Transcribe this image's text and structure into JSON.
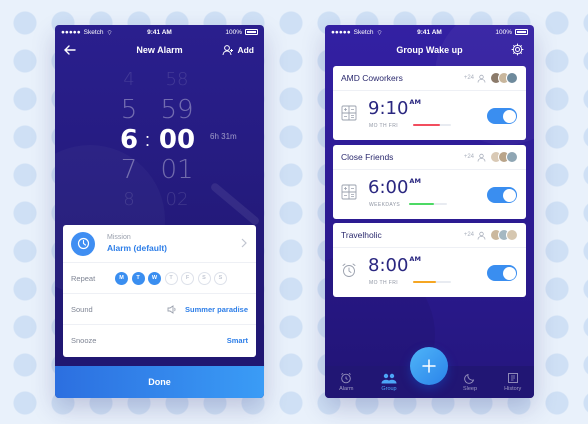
{
  "colors": {
    "accent": "#3a8ef0",
    "phone_bg": "#2a1f8e",
    "red_bar": "#f24d5e",
    "green_bar": "#4cd964",
    "orange_bar": "#f5a623"
  },
  "left_screen": {
    "status": {
      "carrier": "Sketch",
      "time": "9:41 AM",
      "battery": "100%"
    },
    "nav": {
      "title": "New Alarm",
      "back_icon": "arrow-left-icon",
      "add_label": "Add",
      "add_icon": "add-person-icon"
    },
    "picker": {
      "hours": [
        "4",
        "5",
        "6",
        "7",
        "8"
      ],
      "minutes": [
        "58",
        "59",
        "00",
        "01",
        "02"
      ],
      "selected_hour": "6",
      "selected_minute": "00",
      "remaining": "6h 31m"
    },
    "mission": {
      "label": "Mission",
      "value": "Alarm (default)",
      "icon": "clock-icon"
    },
    "repeat": {
      "label": "Repeat",
      "days": [
        {
          "d": "M",
          "on": true
        },
        {
          "d": "T",
          "on": true
        },
        {
          "d": "W",
          "on": true
        },
        {
          "d": "T",
          "on": false
        },
        {
          "d": "F",
          "on": false
        },
        {
          "d": "S",
          "on": false
        },
        {
          "d": "S",
          "on": false
        }
      ]
    },
    "sound": {
      "label": "Sound",
      "value": "Summer paradise",
      "icon": "speaker-icon"
    },
    "snooze": {
      "label": "Snooze",
      "value": "Smart"
    },
    "done_label": "Done"
  },
  "right_screen": {
    "status": {
      "carrier": "Sketch",
      "time": "9:41 AM",
      "battery": "100%"
    },
    "nav": {
      "title": "Group Wake up",
      "settings_icon": "gear-icon"
    },
    "groups": [
      {
        "name": "AMD Coworkers",
        "count": "+24",
        "time": "9:10",
        "ampm": "AM",
        "days": "MO TH FRI",
        "progress": 0.7,
        "bar_color": "#f24d5e",
        "icon": "calculator-icon",
        "enabled": true
      },
      {
        "name": "Close Friends",
        "count": "+24",
        "time": "6:00",
        "ampm": "AM",
        "days": "WEEKDAYS",
        "progress": 0.65,
        "bar_color": "#4cd964",
        "icon": "calculator-icon",
        "enabled": true
      },
      {
        "name": "Travelholic",
        "count": "+24",
        "time": "8:00",
        "ampm": "AM",
        "days": "MO TH FRI",
        "progress": 0.6,
        "bar_color": "#f5a623",
        "icon": "alarm-clock-icon",
        "enabled": true
      }
    ],
    "fab_icon": "plus-icon",
    "tabs": [
      {
        "label": "Alarm",
        "icon": "alarm-clock-icon",
        "active": false
      },
      {
        "label": "Group",
        "icon": "group-icon",
        "active": true
      },
      {
        "label": "Sleep",
        "icon": "moon-icon",
        "active": false
      },
      {
        "label": "History",
        "icon": "history-icon",
        "active": false
      }
    ]
  }
}
